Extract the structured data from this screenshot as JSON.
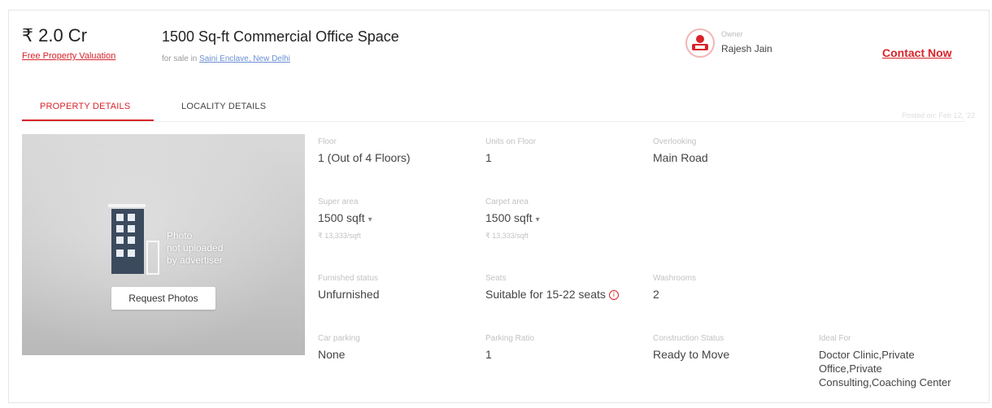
{
  "header": {
    "price": "₹ 2.0 Cr",
    "valuation_link": "Free Property Valuation",
    "title": "1500 Sq-ft Commercial Office Space",
    "subtitle_prefix": "for sale in",
    "locality_link": "Saini Enclave, New Delhi"
  },
  "owner": {
    "role": "Owner",
    "name": "Rajesh Jain",
    "contact_label": "Contact Now"
  },
  "tabs": [
    {
      "label": "PROPERTY DETAILS",
      "active": true
    },
    {
      "label": "LOCALITY DETAILS",
      "active": false
    }
  ],
  "posted_on": "Posted on: Feb 12, '22",
  "photo": {
    "note": "Photo\nnot uploaded\nby advertiser",
    "request_label": "Request Photos"
  },
  "details": {
    "floor": {
      "label": "Floor",
      "value": "1 (Out of 4 Floors)"
    },
    "units_on_floor": {
      "label": "Units on Floor",
      "value": "1"
    },
    "overlooking": {
      "label": "Overlooking",
      "value": "Main Road"
    },
    "super_area": {
      "label": "Super area",
      "value": "1500 sqft",
      "sub": "₹ 13,333/sqft"
    },
    "carpet_area": {
      "label": "Carpet area",
      "value": "1500 sqft",
      "sub": "₹ 13,333/sqft"
    },
    "furnished_status": {
      "label": "Furnished status",
      "value": "Unfurnished"
    },
    "seats": {
      "label": "Seats",
      "value": "Suitable for 15-22 seats"
    },
    "washrooms": {
      "label": "Washrooms",
      "value": "2"
    },
    "car_parking": {
      "label": "Car parking",
      "value": "None"
    },
    "parking_ratio": {
      "label": "Parking Ratio",
      "value": "1"
    },
    "construction_status": {
      "label": "Construction Status",
      "value": "Ready to Move"
    },
    "ideal_for": {
      "label": "Ideal For",
      "value": "Doctor Clinic,Private Office,Private Consulting,Coaching Center"
    }
  },
  "colors": {
    "accent": "#d8232a",
    "link": "#6a8fd1"
  }
}
